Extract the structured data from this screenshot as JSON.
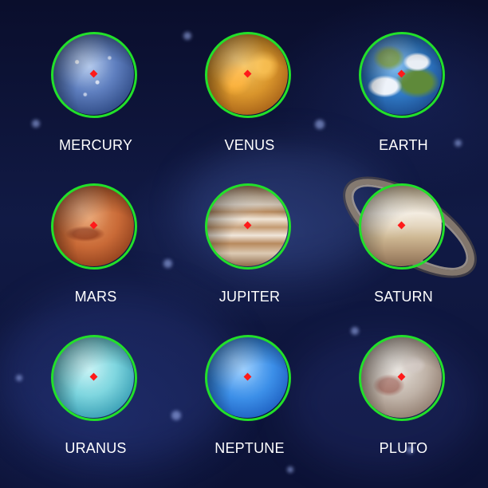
{
  "planets": [
    {
      "name": "MERCURY",
      "key": "mercury",
      "color": "#5f7fbf"
    },
    {
      "name": "VENUS",
      "key": "venus",
      "color": "#d9952c"
    },
    {
      "name": "EARTH",
      "key": "earth",
      "color": "#2f78c4"
    },
    {
      "name": "MARS",
      "key": "mars",
      "color": "#c96a37"
    },
    {
      "name": "JUPITER",
      "key": "jupiter",
      "color": "#d7c2a8"
    },
    {
      "name": "SATURN",
      "key": "saturn",
      "color": "#e8dcc6"
    },
    {
      "name": "URANUS",
      "key": "uranus",
      "color": "#7fd6df"
    },
    {
      "name": "NEPTUNE",
      "key": "neptune",
      "color": "#3c8fe8"
    },
    {
      "name": "PLUTO",
      "key": "pluto",
      "color": "#bfb2a7"
    }
  ],
  "marker": {
    "outline_color": "#22e02a",
    "center_color": "#ff1a1a"
  },
  "background": {
    "base": "#0b1030"
  }
}
